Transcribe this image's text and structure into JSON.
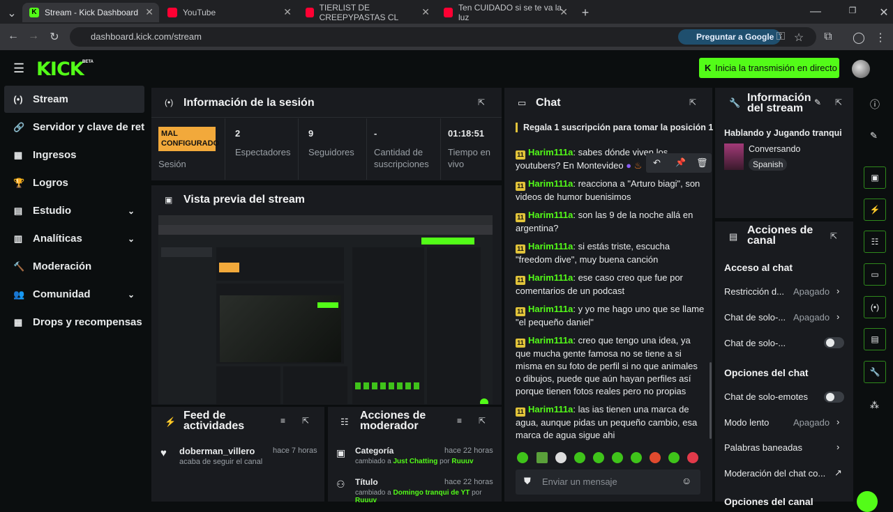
{
  "browser": {
    "tabs": [
      {
        "title": "Stream - Kick Dashboard"
      },
      {
        "title": "YouTube"
      },
      {
        "title": "TIERLIST DE CREEPYPASTAS CL"
      },
      {
        "title": "Ten CUIDADO si se te va la luz"
      }
    ],
    "url": "dashboard.kick.com/stream",
    "google_button": "Preguntar a Google"
  },
  "header": {
    "logo": "KICK",
    "beta": "BETA",
    "golive": "Inicia la transmisión en directo"
  },
  "sidebar": {
    "items": [
      {
        "label": "Stream",
        "icon": "(•)"
      },
      {
        "label": "Servidor y clave de retrans",
        "icon": "🔗"
      },
      {
        "label": "Ingresos",
        "icon": "▦"
      },
      {
        "label": "Logros",
        "icon": "🏆"
      },
      {
        "label": "Estudio",
        "icon": "▤"
      },
      {
        "label": "Analíticas",
        "icon": "▥"
      },
      {
        "label": "Moderación",
        "icon": "🔨"
      },
      {
        "label": "Comunidad",
        "icon": "👥"
      },
      {
        "label": "Drops y recompensas",
        "icon": "▦"
      }
    ]
  },
  "session": {
    "title": "Información de la sesión",
    "badge": "MAL CONFIGURADO",
    "badge_label": "Sesión",
    "stats": [
      {
        "value": "2",
        "label": "Espectadores"
      },
      {
        "value": "9",
        "label": "Seguidores"
      },
      {
        "value": "-",
        "label": "Cantidad de suscripciones"
      },
      {
        "value": "01:18:51",
        "label": "Tiempo en vivo"
      }
    ]
  },
  "preview": {
    "title": "Vista previa del stream"
  },
  "activity": {
    "title": "Feed de actividades",
    "items": [
      {
        "user": "doberman_villero",
        "time": "hace 7 horas",
        "detail": "acaba de seguir el canal"
      }
    ]
  },
  "mod_actions": {
    "title": "Acciones de moderador",
    "items": [
      {
        "title": "Categoría",
        "time": "hace 22 horas",
        "prefix": "cambiado a ",
        "value": "Just Chatting",
        "by": " por ",
        "user": "Ruuuv"
      },
      {
        "title": "Título",
        "time": "hace 22 horas",
        "prefix": "cambiado a ",
        "value": "Domingo tranqui de YT",
        "by": " por",
        "user": "Ruuuv"
      }
    ]
  },
  "chat": {
    "title": "Chat",
    "pinned": "Regala 1 suscripción para tomar la posición 1",
    "messages": [
      {
        "user": "Harim111a",
        "text": ": sabes dónde viven los youtubers? En Montevideo"
      },
      {
        "user": "Harim111a",
        "text": ": reacciona a \"Arturo biagi\", son videos de humor buenisimos"
      },
      {
        "user": "Harim111a",
        "text": ": son las 9 de la noche allá en argentina?"
      },
      {
        "user": "Harim111a",
        "text": ": si estás triste, escucha \"freedom dive\", muy buena canción"
      },
      {
        "user": "Harim111a",
        "text": ": ese caso creo que fue por comentarios de un podcast"
      },
      {
        "user": "Harim111a",
        "text": ": y yo me hago uno que se llame \"el pequeño daniel\""
      },
      {
        "user": "Harim111a",
        "text": ": creo que tengo una idea, ya que mucha gente famosa no se tiene a si misma en su foto de perfil si no que animales o dibujos, puede que aún hayan perfiles así porque tienen fotos reales pero no propias"
      },
      {
        "user": "Harim111a",
        "text": ": las ias tienen una marca de agua, aunque pidas un pequeño cambio, esa marca de agua sigue ahi"
      }
    ],
    "badge": "11",
    "input_placeholder": "Enviar un mensaje"
  },
  "stream_info": {
    "title_line1": "Información",
    "title_line2": "del stream",
    "stream_title": "Hablando y Jugando tranqui",
    "category": "Conversando",
    "tag": "Spanish"
  },
  "channel_actions": {
    "title_line1": "Acciones de",
    "title_line2": "canal",
    "access_heading": "Acceso al chat",
    "rows": [
      {
        "label": "Restricción d...",
        "value": "Apagado"
      },
      {
        "label": "Chat de solo-...",
        "value": "Apagado"
      },
      {
        "label": "Chat de solo-...",
        "value": ""
      }
    ],
    "options_heading": "Opciones del chat",
    "options": [
      {
        "label": "Chat de solo-emotes",
        "value": ""
      },
      {
        "label": "Modo lento",
        "value": "Apagado"
      },
      {
        "label": "Palabras baneadas",
        "value": ""
      },
      {
        "label": "Moderación del chat co...",
        "value": ""
      }
    ],
    "next_heading": "Opciones del canal"
  }
}
